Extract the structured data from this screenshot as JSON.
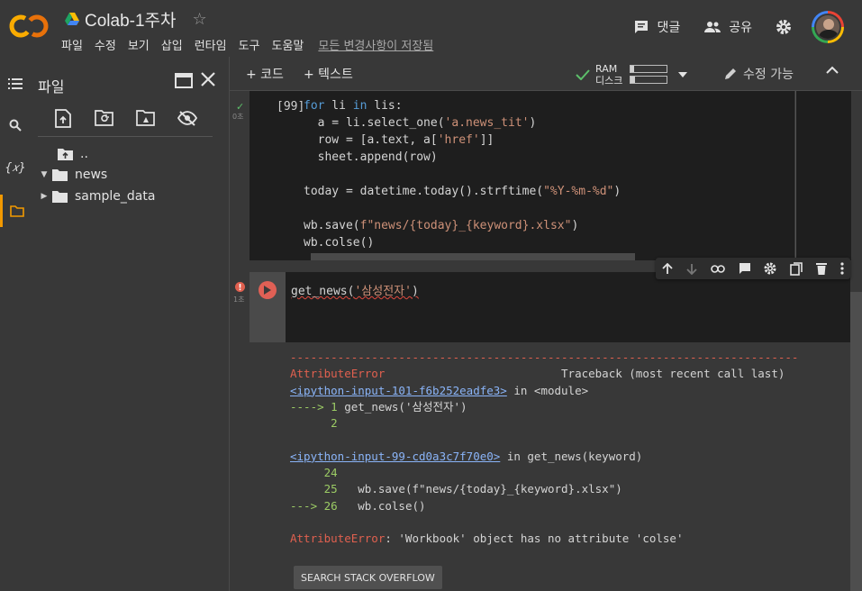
{
  "app": {
    "logo": "CO",
    "notebook_title": "Colab-1주차",
    "saved_status": "모든 변경사항이 저장됨"
  },
  "menu": [
    "파일",
    "수정",
    "보기",
    "삽입",
    "런타임",
    "도구",
    "도움말"
  ],
  "header_actions": {
    "comment_label": "댓글",
    "share_label": "공유"
  },
  "sidebar": {
    "title": "파일",
    "tree": [
      {
        "label": ".."
      },
      {
        "label": "news",
        "expanded": true
      },
      {
        "label": "sample_data",
        "expanded": false
      }
    ]
  },
  "toolbar": {
    "add_code": "+ 코드",
    "add_text": "+ 텍스트",
    "ram_label": "RAM",
    "disk_label": "디스크",
    "ram_usage": 0.08,
    "disk_usage": 0.12,
    "edit_mode": "수정 가능"
  },
  "cell1": {
    "prompt": "[99]",
    "time": "0초",
    "code_lines": [
      "for li in lis:",
      "  a = li.select_one('a.news_tit')",
      "  row = [a.text, a['href']]",
      "  sheet.append(row)",
      "",
      "today = datetime.today().strftime(\"%Y-%m-%d\")",
      "",
      "wb.save(f\"news/{today}_{keyword}.xlsx\")",
      "wb.colse()"
    ]
  },
  "cell2": {
    "time": "1초",
    "code": "get_news('삼성전자')",
    "output": {
      "dashes": "---------------------------------------------------------------------------",
      "error_name": "AttributeError",
      "traceback_header": "Traceback (most recent call last)",
      "link1": "<ipython-input-101-f6b252eadfe3>",
      "in_module": " in <module>",
      "arrow1": "----> 1 get_news('삼성전자')",
      "line2": "      2",
      "link2": "<ipython-input-99-cd0a3c7f70e0>",
      "in_func": " in get_news(keyword)",
      "line24": "     24",
      "line25": "     25   wb.save(f\"news/{today}_{keyword}.xlsx\")",
      "arrow26": "---> 26   wb.colse()",
      "final_error": "AttributeError",
      "final_msg": ": 'Workbook' object has no attribute 'colse'"
    },
    "so_button": "SEARCH STACK OVERFLOW"
  },
  "colors": {
    "accent_orange": "#f29900",
    "error_red": "#e0604f",
    "success_green": "#5cbf6a",
    "link_blue": "#8ab4f8"
  }
}
